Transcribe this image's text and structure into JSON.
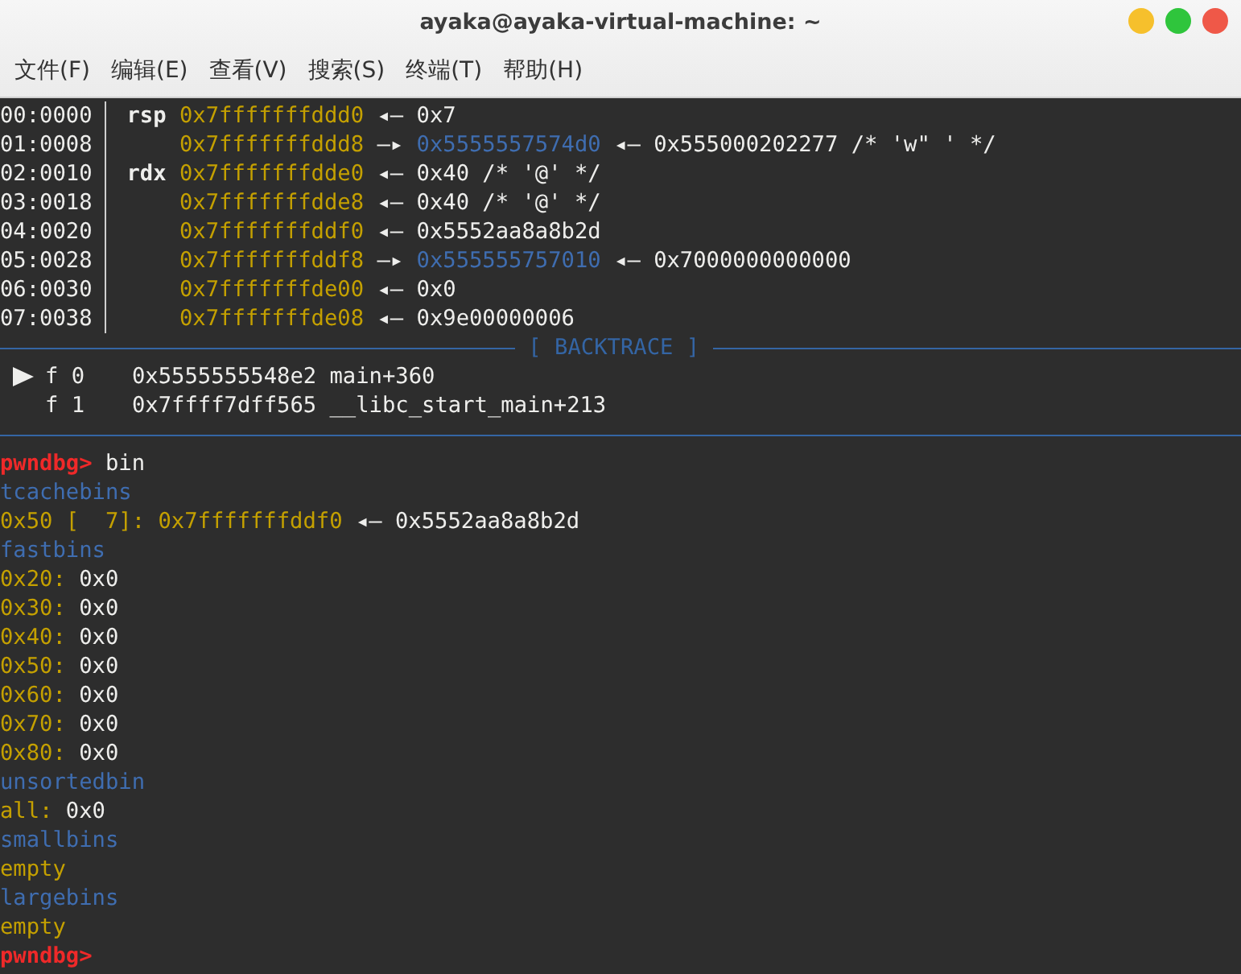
{
  "window": {
    "title": "ayaka@ayaka-virtual-machine: ~"
  },
  "menu": [
    "文件(F)",
    "编辑(E)",
    "查看(V)",
    "搜索(S)",
    "终端(T)",
    "帮助(H)"
  ],
  "terminal": {
    "lines": [
      {
        "kind": "stack",
        "index": "00:0000",
        "register": "rsp",
        "segments": [
          {
            "text": "0x7fffffffddd0",
            "kind": "stack"
          },
          {
            "text": "◂—",
            "kind": "plain"
          },
          {
            "text": "0x7",
            "kind": "plain"
          }
        ]
      },
      {
        "kind": "stack",
        "index": "01:0008",
        "segments": [
          {
            "text": "0x7fffffffddd8",
            "kind": "stack"
          },
          {
            "text": "—▸",
            "kind": "plain"
          },
          {
            "text": "0x5555557574d0",
            "kind": "heap"
          },
          {
            "text": "◂—",
            "kind": "plain"
          },
          {
            "text": "0x555000202277 /* 'w\" ' */",
            "kind": "plain"
          }
        ]
      },
      {
        "kind": "stack",
        "index": "02:0010",
        "register": "rdx",
        "segments": [
          {
            "text": "0x7fffffffdde0",
            "kind": "stack"
          },
          {
            "text": "◂—",
            "kind": "plain"
          },
          {
            "text": "0x40 /* '@' */",
            "kind": "plain"
          }
        ]
      },
      {
        "kind": "stack",
        "index": "03:0018",
        "segments": [
          {
            "text": "0x7fffffffdde8",
            "kind": "stack"
          },
          {
            "text": "◂—",
            "kind": "plain"
          },
          {
            "text": "0x40 /* '@' */",
            "kind": "plain"
          }
        ]
      },
      {
        "kind": "stack",
        "index": "04:0020",
        "segments": [
          {
            "text": "0x7fffffffddf0",
            "kind": "stack"
          },
          {
            "text": "◂—",
            "kind": "plain"
          },
          {
            "text": "0x5552aa8a8b2d",
            "kind": "plain"
          }
        ]
      },
      {
        "kind": "stack",
        "index": "05:0028",
        "segments": [
          {
            "text": "0x7fffffffddf8",
            "kind": "stack"
          },
          {
            "text": "—▸",
            "kind": "plain"
          },
          {
            "text": "0x555555757010",
            "kind": "heap"
          },
          {
            "text": "◂—",
            "kind": "plain"
          },
          {
            "text": "0x7000000000000",
            "kind": "plain"
          }
        ]
      },
      {
        "kind": "stack",
        "index": "06:0030",
        "segments": [
          {
            "text": "0x7fffffffde00",
            "kind": "stack"
          },
          {
            "text": "◂—",
            "kind": "plain"
          },
          {
            "text": "0x0",
            "kind": "plain"
          }
        ]
      },
      {
        "kind": "stack",
        "index": "07:0038",
        "segments": [
          {
            "text": "0x7fffffffde08",
            "kind": "stack"
          },
          {
            "text": "◂—",
            "kind": "plain"
          },
          {
            "text": "0x9e00000006",
            "kind": "plain"
          }
        ]
      },
      {
        "kind": "divider",
        "label": "[ BACKTRACE ]"
      },
      {
        "kind": "frame",
        "selected": true,
        "number": "f 0",
        "address": "0x5555555548e2",
        "symbol": "main+360"
      },
      {
        "kind": "frame",
        "selected": false,
        "number": "f 1",
        "address": "0x7ffff7dff565",
        "symbol": "__libc_start_main+213"
      },
      {
        "kind": "divider"
      },
      {
        "kind": "text",
        "segments": [
          {
            "text": "pwndbg>",
            "kind": "prompt"
          },
          {
            "text": "bin",
            "kind": "plain"
          }
        ]
      },
      {
        "kind": "text",
        "segments": [
          {
            "text": "tcachebins",
            "kind": "header"
          }
        ]
      },
      {
        "kind": "text",
        "segments": [
          {
            "text": "0x50 [  7]:",
            "kind": "stack"
          },
          {
            "text": "0x7fffffffddf0",
            "kind": "stack"
          },
          {
            "text": "◂—",
            "kind": "plain"
          },
          {
            "text": "0x5552aa8a8b2d",
            "kind": "plain"
          }
        ]
      },
      {
        "kind": "text",
        "segments": [
          {
            "text": "fastbins",
            "kind": "header"
          }
        ]
      },
      {
        "kind": "text",
        "segments": [
          {
            "text": "0x20:",
            "kind": "stack"
          },
          {
            "text": "0x0",
            "kind": "plain"
          }
        ]
      },
      {
        "kind": "text",
        "segments": [
          {
            "text": "0x30:",
            "kind": "stack"
          },
          {
            "text": "0x0",
            "kind": "plain"
          }
        ]
      },
      {
        "kind": "text",
        "segments": [
          {
            "text": "0x40:",
            "kind": "stack"
          },
          {
            "text": "0x0",
            "kind": "plain"
          }
        ]
      },
      {
        "kind": "text",
        "segments": [
          {
            "text": "0x50:",
            "kind": "stack"
          },
          {
            "text": "0x0",
            "kind": "plain"
          }
        ]
      },
      {
        "kind": "text",
        "segments": [
          {
            "text": "0x60:",
            "kind": "stack"
          },
          {
            "text": "0x0",
            "kind": "plain"
          }
        ]
      },
      {
        "kind": "text",
        "segments": [
          {
            "text": "0x70:",
            "kind": "stack"
          },
          {
            "text": "0x0",
            "kind": "plain"
          }
        ]
      },
      {
        "kind": "text",
        "segments": [
          {
            "text": "0x80:",
            "kind": "stack"
          },
          {
            "text": "0x0",
            "kind": "plain"
          }
        ]
      },
      {
        "kind": "text",
        "segments": [
          {
            "text": "unsortedbin",
            "kind": "header"
          }
        ]
      },
      {
        "kind": "text",
        "segments": [
          {
            "text": "all:",
            "kind": "stack"
          },
          {
            "text": "0x0",
            "kind": "plain"
          }
        ]
      },
      {
        "kind": "text",
        "segments": [
          {
            "text": "smallbins",
            "kind": "header"
          }
        ]
      },
      {
        "kind": "text",
        "segments": [
          {
            "text": "empty",
            "kind": "stack"
          }
        ]
      },
      {
        "kind": "text",
        "segments": [
          {
            "text": "largebins",
            "kind": "header"
          }
        ]
      },
      {
        "kind": "text",
        "segments": [
          {
            "text": "empty",
            "kind": "stack"
          }
        ]
      },
      {
        "kind": "text",
        "segments": [
          {
            "text": "pwndbg>",
            "kind": "prompt"
          }
        ]
      }
    ]
  }
}
